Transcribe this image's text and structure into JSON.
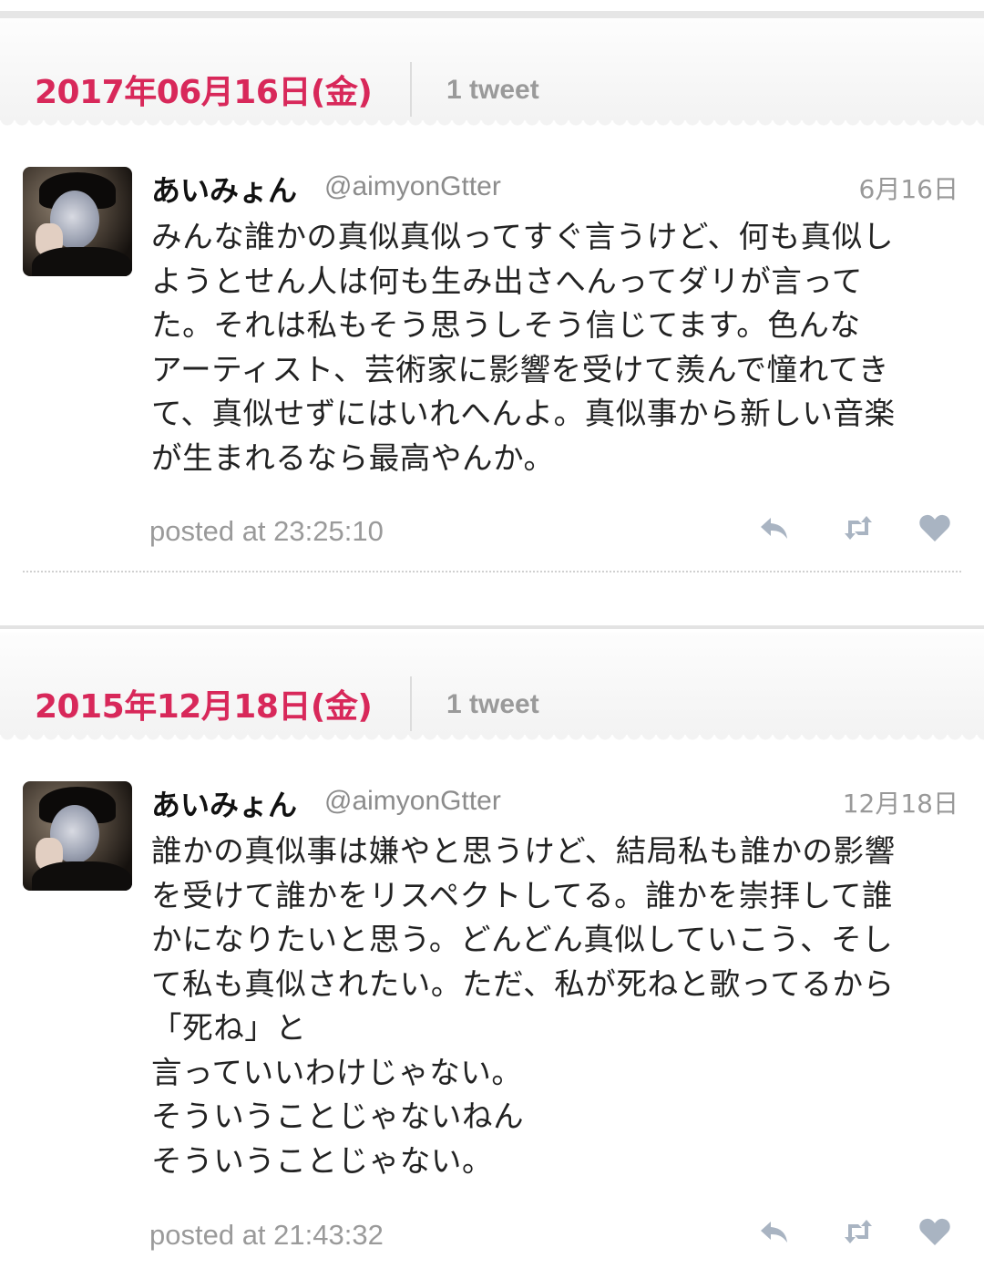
{
  "sections": [
    {
      "date": "2017年06月16日(金)",
      "count": "1 tweet",
      "tweet": {
        "display_name": "あいみょん",
        "handle": "@aimyonGtter",
        "date": "6月16日",
        "text": "みんな誰かの真似真似ってすぐ言うけど、何も真似し\nようとせん人は何も生み出さへんってダリが言って\nた。それは私もそう思うしそう信じてます。色んな\nアーティスト、芸術家に影響を受けて羨んで憧れてき\nて、真似せずにはいれへんよ。真似事から新しい音楽\nが生まれるなら最高やんか。",
        "posted": "posted at 23:25:10"
      }
    },
    {
      "date": "2015年12月18日(金)",
      "count": "1 tweet",
      "tweet": {
        "display_name": "あいみょん",
        "handle": "@aimyonGtter",
        "date": "12月18日",
        "text": "誰かの真似事は嫌やと思うけど、結局私も誰かの影響\nを受けて誰かをリスペクトしてる。誰かを崇拝して誰\nかになりたいと思う。どんどん真似していこう、そし\nて私も真似されたい。ただ、私が死ねと歌ってるから\n「死ね」と\n言っていいわけじゃない。\nそういうことじゃないねん\nそういうことじゃない。",
        "posted": "posted at 21:43:32"
      }
    }
  ],
  "icons": {
    "reply": "reply-icon",
    "retweet": "retweet-icon",
    "like": "heart-icon",
    "color": "#a9b4c2"
  },
  "accent_color": "#d8285a"
}
